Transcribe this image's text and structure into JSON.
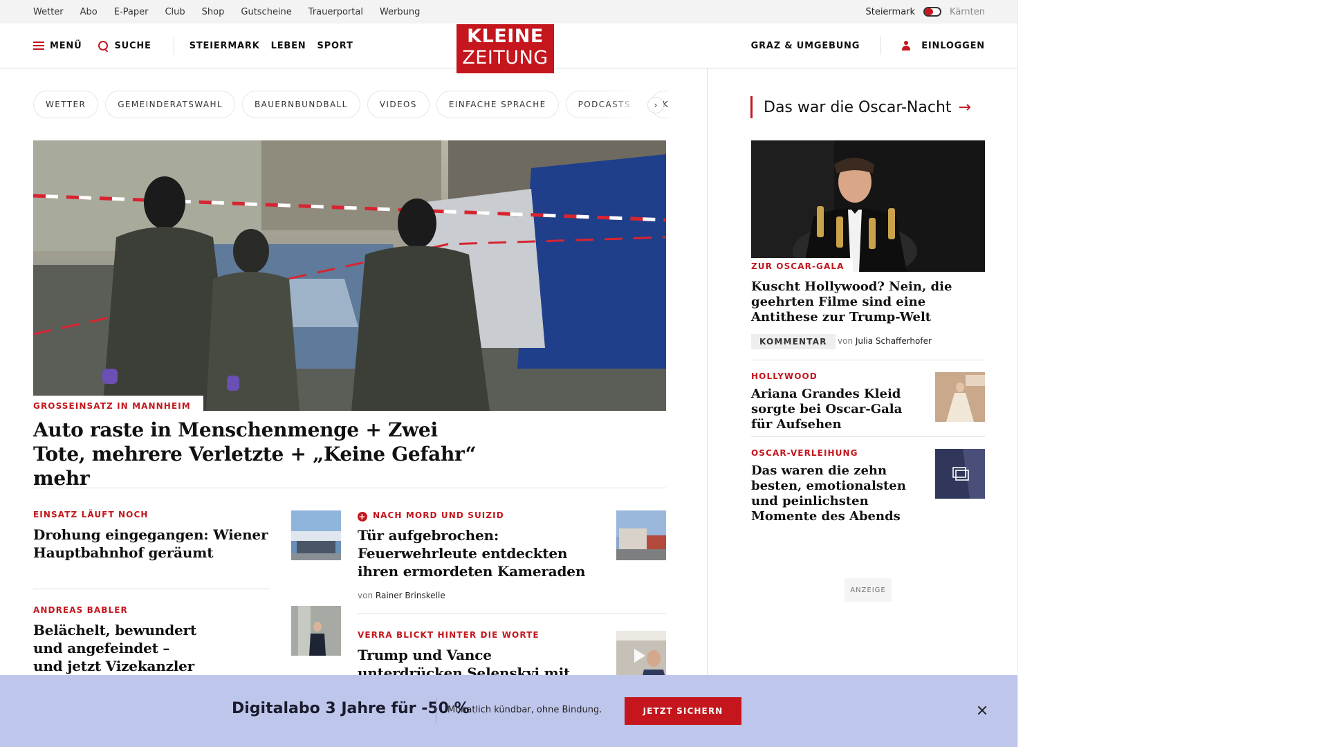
{
  "utility_nav": [
    "Wetter",
    "Abo",
    "E-Paper",
    "Club",
    "Shop",
    "Gutscheine",
    "Trauerportal",
    "Werbung"
  ],
  "region": {
    "active": "Steiermark",
    "inactive": "Kärnten"
  },
  "header": {
    "menu_label": "MENÜ",
    "search_label": "SUCHE",
    "sections": [
      "STEIERMARK",
      "LEBEN",
      "SPORT"
    ],
    "logo_line1": "KLEINE",
    "logo_line2": "ZEITUNG",
    "local_label": "GRAZ & UMGEBUNG",
    "login_label": "EINLOGGEN"
  },
  "topic_pills": [
    "WETTER",
    "GEMEINDERATSWAHL",
    "BAUERNBUNDBALL",
    "VIDEOS",
    "EINFACHE SPRACHE",
    "PODCASTS",
    "KLE"
  ],
  "pills_next": "›",
  "hero": {
    "kicker": "GROSSEINSATZ IN MANNHEIM",
    "title": "Auto raste in Menschenmenge + Zwei Tote, mehrere Verletzte + „Keine Gefahr“ mehr"
  },
  "teasers": [
    {
      "kicker": "EINSATZ LÄUFT NOCH",
      "title": "Drohung eingegangen: Wiener Hauptbahnhof geräumt"
    },
    {
      "kicker": "NACH MORD UND SUIZID",
      "title": "Tür aufgebrochen: Feuerwehrleute entdeckten ihren ermordeten Kameraden",
      "byline_prefix": "von",
      "author": "Rainer Brinskelle"
    },
    {
      "kicker": "ANDREAS BABLER",
      "title": "Belächelt, bewundert und angefeindet – und jetzt Vizekanzler"
    },
    {
      "kicker": "VERRA BLICKT HINTER DIE WORTE",
      "title": "Trump und Vance unterdrücken Selenskyi mit jeder Geste"
    }
  ],
  "sidebar": {
    "heading": "Das war die Oscar-Nacht",
    "heading_arrow": "→",
    "lead": {
      "kicker": "ZUR OSCAR-GALA",
      "title": "Kuscht Hollywood? Nein, die geehrten Filme sind eine Antithese zur Trump-Welt",
      "badge": "KOMMENTAR",
      "byline_prefix": "von",
      "author": "Julia Schafferhofer"
    },
    "items": [
      {
        "kicker": "HOLLYWOOD",
        "title": "Ariana Grandes Kleid sorgte bei Oscar-Gala für Aufsehen"
      },
      {
        "kicker": "OSCAR-VERLEIHUNG",
        "title": "Das waren die zehn besten, emotionalsten und peinlichsten Momente des Abends"
      }
    ],
    "ad_label": "ANZEIGE"
  },
  "promo": {
    "title": "Digitalabo 3 Jahre für -50 %",
    "subtitle": "Monatlich kündbar, ohne Bindung.",
    "cta": "JETZT SICHERN"
  },
  "colors": {
    "brand_red": "#c4161c",
    "promo_bg": "#bfc6ec"
  }
}
